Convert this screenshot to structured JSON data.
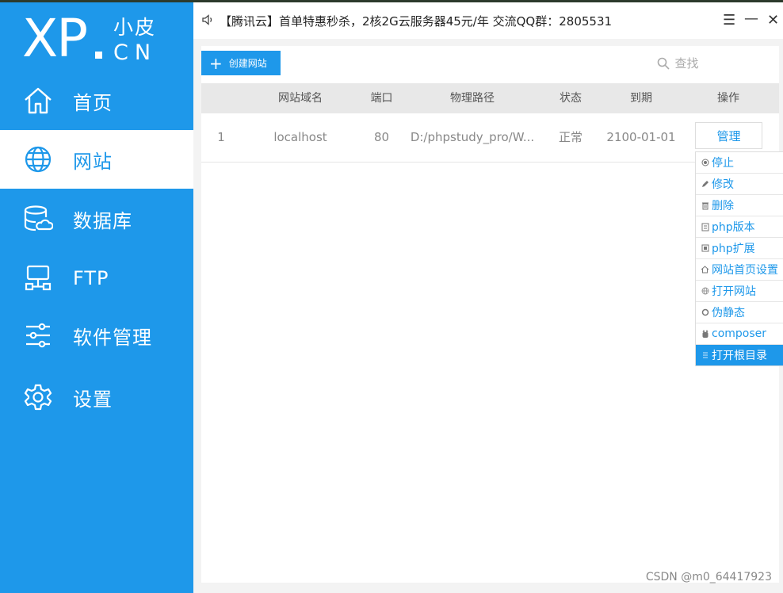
{
  "sidebar": {
    "logo": {
      "main": "XP",
      "cn_top": "小皮",
      "cn_bottom": "CN"
    },
    "items": [
      {
        "label": "首页",
        "icon": "home-icon"
      },
      {
        "label": "网站",
        "icon": "globe-icon",
        "active": true
      },
      {
        "label": "数据库",
        "icon": "database-icon"
      },
      {
        "label": "FTP",
        "icon": "ftp-icon"
      },
      {
        "label": "软件管理",
        "icon": "sliders-icon"
      },
      {
        "label": "设置",
        "icon": "gear-icon"
      }
    ]
  },
  "titlebar": {
    "notice": "【腾讯云】首单特惠秒杀，2核2G云服务器45元/年 交流QQ群：2805531",
    "menu_glyph": "☰",
    "minimize_glyph": "—",
    "close_glyph": "✕"
  },
  "toolbar": {
    "create_label": "创建网站",
    "search_label": "查找"
  },
  "table": {
    "headers": {
      "domain": "网站域名",
      "port": "端口",
      "path": "物理路径",
      "status": "状态",
      "expiry": "到期",
      "action": "操作"
    },
    "rows": [
      {
        "index": "1",
        "domain": "localhost",
        "port": "80",
        "path": "D:/phpstudy_pro/W...",
        "status": "正常",
        "expiry": "2100-01-01",
        "action": "管理"
      }
    ]
  },
  "menu": {
    "items": [
      {
        "label": "停止",
        "icon": "stop-icon"
      },
      {
        "label": "修改",
        "icon": "edit-icon"
      },
      {
        "label": "删除",
        "icon": "trash-icon"
      },
      {
        "label": "php版本",
        "icon": "php-version-icon"
      },
      {
        "label": "php扩展",
        "icon": "php-extension-icon"
      },
      {
        "label": "网站首页设置",
        "icon": "home-small-icon"
      },
      {
        "label": "打开网站",
        "icon": "globe-small-icon"
      },
      {
        "label": "伪静态",
        "icon": "rewrite-icon"
      },
      {
        "label": "composer",
        "icon": "composer-icon"
      },
      {
        "label": "打开根目录",
        "icon": "folder-list-icon",
        "hover": true
      }
    ]
  },
  "watermark": "CSDN @m0_64417923",
  "colors": {
    "accent": "#1e98ea",
    "sidebar": "#1e98ea",
    "background": "#f3f3f3"
  }
}
